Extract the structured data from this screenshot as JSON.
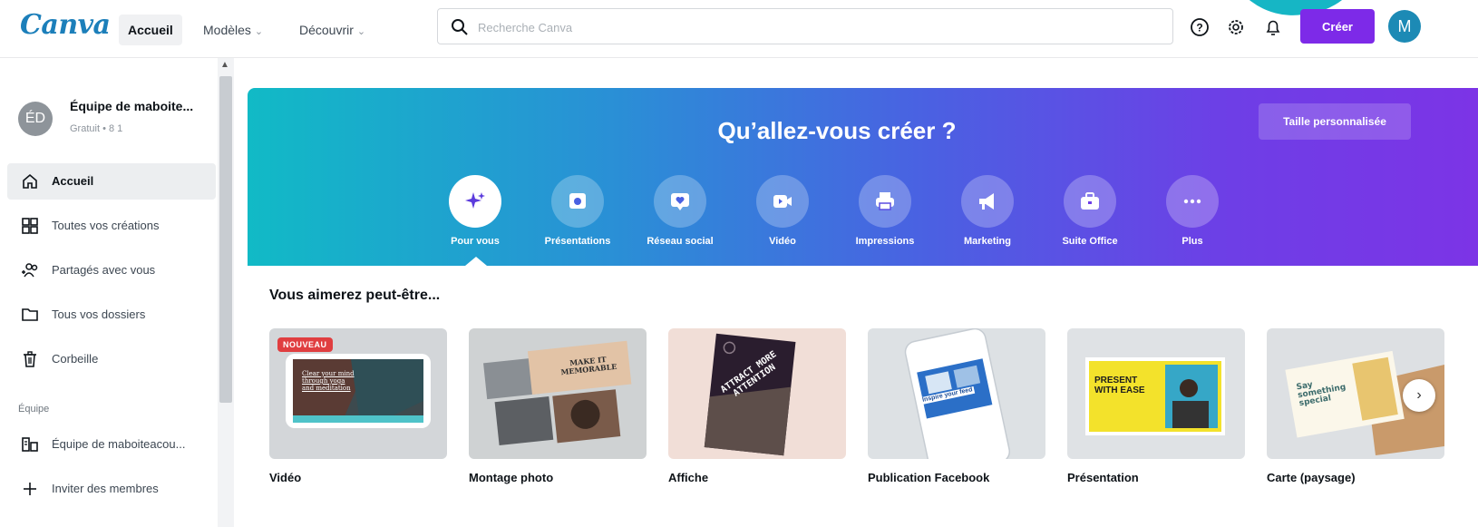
{
  "topbar": {
    "logo": "Canva",
    "nav": [
      {
        "label": "Accueil",
        "has_chevron": false
      },
      {
        "label": "Modèles",
        "has_chevron": true
      },
      {
        "label": "Découvrir",
        "has_chevron": true
      }
    ],
    "search_placeholder": "Recherche Canva",
    "icons": [
      "help-icon",
      "settings-icon",
      "notification-bell-icon"
    ],
    "create_label": "Créer",
    "avatar_letter": "M"
  },
  "sidebar": {
    "team": {
      "initials": "ÉD",
      "name": "Équipe de maboite...",
      "meta": "Gratuit • 8 1"
    },
    "items": [
      {
        "label": "Accueil",
        "icon": "home-icon",
        "active": true
      },
      {
        "label": "Toutes vos créations",
        "icon": "grid-icon",
        "active": false
      },
      {
        "label": "Partagés avec vous",
        "icon": "shared-users-icon",
        "active": false
      },
      {
        "label": "Tous vos dossiers",
        "icon": "folder-icon",
        "active": false
      },
      {
        "label": "Corbeille",
        "icon": "trash-icon",
        "active": false
      }
    ],
    "section_label": "Équipe",
    "team_items": [
      {
        "label": "Équipe de maboiteacou...",
        "icon": "team-icon"
      },
      {
        "label": "Inviter des membres",
        "icon": "plus-icon"
      }
    ]
  },
  "hero": {
    "title": "Qu’allez-vous créer ?",
    "custom_size_label": "Taille personnalisée",
    "categories": [
      {
        "label": "Pour vous",
        "icon": "sparkle-icon",
        "active": true
      },
      {
        "label": "Présentations",
        "icon": "presentation-icon",
        "active": false
      },
      {
        "label": "Réseau social",
        "icon": "heart-chat-icon",
        "active": false
      },
      {
        "label": "Vidéo",
        "icon": "video-camera-icon",
        "active": false
      },
      {
        "label": "Impressions",
        "icon": "printer-icon",
        "active": false
      },
      {
        "label": "Marketing",
        "icon": "megaphone-icon",
        "active": false
      },
      {
        "label": "Suite Office",
        "icon": "briefcase-icon",
        "active": false
      },
      {
        "label": "Plus",
        "icon": "more-dots-icon",
        "active": false
      }
    ]
  },
  "suggestions": {
    "title": "Vous aimerez peut-être...",
    "badge": "NOUVEAU",
    "cards": [
      {
        "label": "Vidéo",
        "thumb_text": "Clear your mind through yoga and meditation"
      },
      {
        "label": "Montage photo",
        "thumb_text": "MAKE IT MEMORABLE"
      },
      {
        "label": "Affiche",
        "thumb_text": "ATTRACT MORE ATTENTION"
      },
      {
        "label": "Publication Facebook",
        "thumb_text": "Inspire your feed"
      },
      {
        "label": "Présentation",
        "thumb_text": "PRESENT WITH EASE"
      },
      {
        "label": "Carte (paysage)",
        "thumb_text": "Say something special"
      }
    ],
    "next_glyph": "›"
  }
}
